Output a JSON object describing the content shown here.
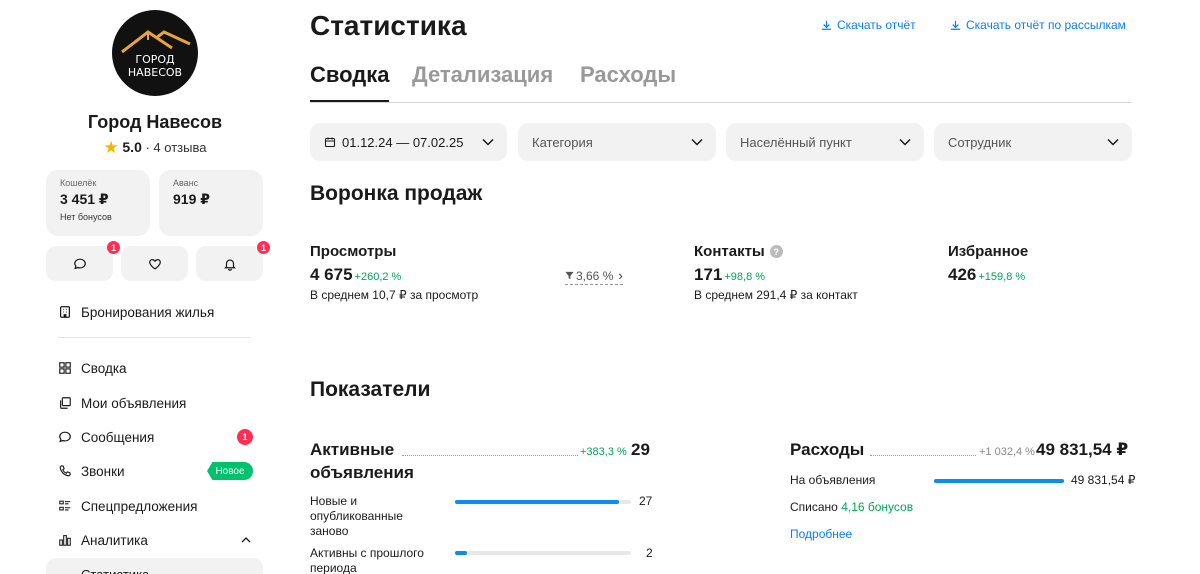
{
  "profile": {
    "logo_text_line1": "ГОРОД",
    "logo_text_line2": "НАВЕСОВ",
    "name": "Город Навесов",
    "rating": "5.0",
    "reviews": "· 4 отзыва"
  },
  "wallet": {
    "caption": "Кошелёк",
    "value": "3 451 ₽",
    "sub": "Нет бонусов"
  },
  "advance": {
    "caption": "Аванс",
    "value": "919 ₽"
  },
  "quick_actions": {
    "messages_badge": "1",
    "notifications_badge": "1"
  },
  "nav": {
    "booking": "Бронирования жилья",
    "summary": "Сводка",
    "listings": "Мои объявления",
    "messages": "Сообщения",
    "messages_badge": "1",
    "calls": "Звонки",
    "calls_badge": "Новое",
    "offers": "Спецпредложения",
    "analytics": "Аналитика",
    "statistics": "Статистика"
  },
  "header": {
    "title": "Статистика",
    "download_report": "Скачать отчёт",
    "download_mailing_report": "Скачать отчёт по рассылкам"
  },
  "tabs": [
    "Сводка",
    "Детализация",
    "Расходы"
  ],
  "filters": {
    "date_range": "01.12.24 — 07.02.25",
    "category": "Категория",
    "locality": "Населённый пункт",
    "employee": "Сотрудник"
  },
  "funnel": {
    "title": "Воронка продаж",
    "views": {
      "label": "Просмотры",
      "value": "4 675",
      "delta": "+260,2 %",
      "sub": "В среднем 10,7 ₽ за просмотр"
    },
    "conversion": "3,66 %",
    "contacts": {
      "label": "Контакты",
      "value": "171",
      "delta": "+98,8 %",
      "sub": "В среднем 291,4 ₽ за контакт",
      "help": "?"
    },
    "favorites": {
      "label": "Избранное",
      "value": "426",
      "delta": "+159,8 %"
    }
  },
  "indicators": {
    "title": "Показатели",
    "active": {
      "label": "Активные объявления",
      "delta": "+383,3 %",
      "value": "29",
      "rows": [
        {
          "label": "Новые и опубликованные заново",
          "value": "27",
          "fraction": 0.93
        },
        {
          "label": "Активны с прошлого периода",
          "value": "2",
          "fraction": 0.07
        }
      ]
    },
    "expenses": {
      "label": "Расходы",
      "delta": "+1 032,4 %",
      "value": "49 831,54 ₽",
      "row_label": "На объявления",
      "row_value": "49 831,54 ₽",
      "row_fraction": 1.0,
      "written_off_prefix": "Списано",
      "written_off_bonus": "4,16 бонусов",
      "more": "Подробнее"
    }
  },
  "colors": {
    "accent": "#0a7cff",
    "positive": "#00a55a",
    "badge": "#ff2e55",
    "new_badge": "#00c26c",
    "bar": "#0a8cf0",
    "negative_delta": "#888888"
  }
}
